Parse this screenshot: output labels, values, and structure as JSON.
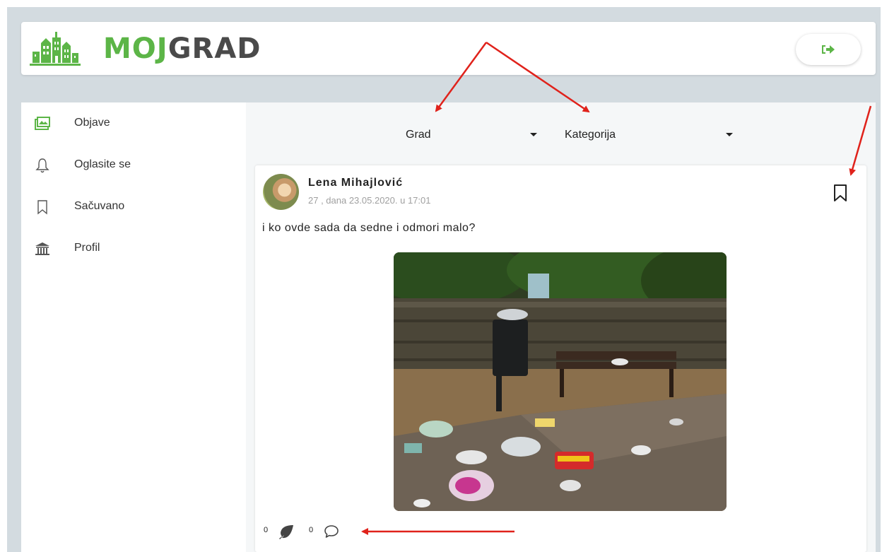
{
  "app": {
    "logo_text_part1": "MOJ",
    "logo_text_part2": "GRAD",
    "logout_icon": "sign-out-icon"
  },
  "colors": {
    "brand_green": "#5cb547",
    "brand_dark": "#4a4a4a",
    "background": "#d3dbe0",
    "annotation_red": "#e0221b"
  },
  "sidebar": {
    "items": [
      {
        "label": "Objave",
        "icon": "posts-icon",
        "active": true
      },
      {
        "label": "Oglasite se",
        "icon": "bell-icon",
        "active": false
      },
      {
        "label": "Sačuvano",
        "icon": "bookmark-icon",
        "active": false
      },
      {
        "label": "Profil",
        "icon": "institution-icon",
        "active": false
      }
    ]
  },
  "filters": {
    "city": {
      "label": "Grad"
    },
    "category": {
      "label": "Kategorija"
    }
  },
  "post": {
    "author": "Lena Mihajlović",
    "meta": "27 , dana 23.05.2020. u 17:01",
    "text": "i ko ovde sada da sedne i odmori malo?",
    "likes": "0",
    "comments": "0",
    "bookmark_icon": "bookmark-icon",
    "like_icon": "leaf-icon",
    "comment_icon": "comment-icon"
  }
}
